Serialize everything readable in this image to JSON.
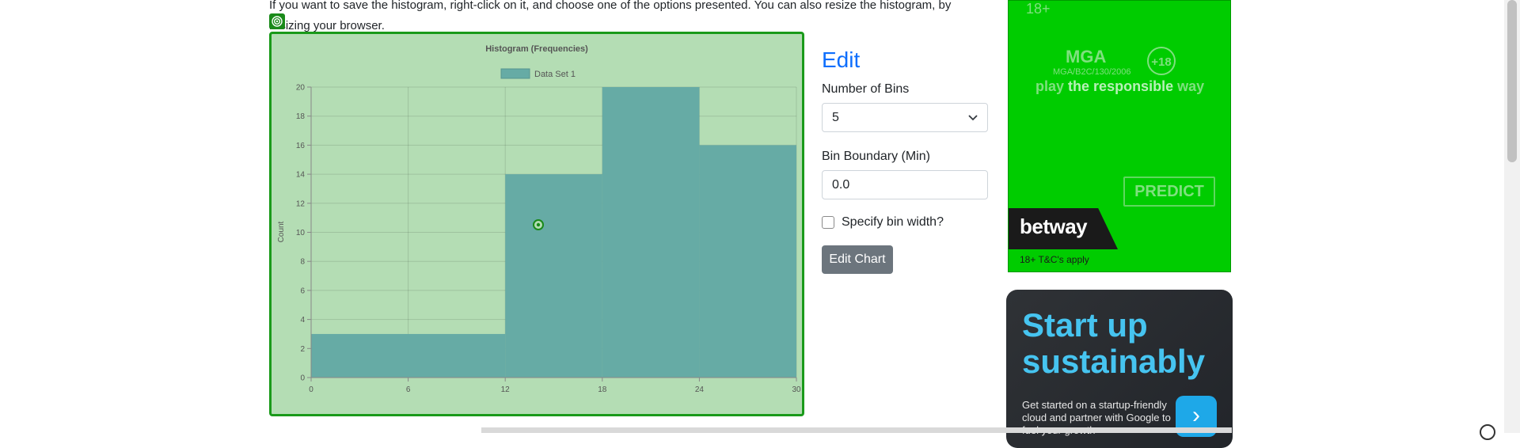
{
  "intro": {
    "line1": "If you want to save the histogram, right-click on it, and choose one of the options presented. You can also resize the histogram, by",
    "line2": "resizing your browser."
  },
  "chart_data": {
    "type": "bar",
    "title": "Histogram (Frequencies)",
    "legend": "Data Set 1",
    "legend_position": "top",
    "xlabel": "",
    "ylabel": "Count",
    "bins": [
      {
        "x0": 0,
        "x1": 12,
        "count": 3
      },
      {
        "x0": 12,
        "x1": 18,
        "count": 14
      },
      {
        "x0": 18,
        "x1": 24,
        "count": 20
      },
      {
        "x0": 24,
        "x1": 30,
        "count": 16
      }
    ],
    "x_ticks": [
      0,
      6,
      12,
      18,
      24,
      30
    ],
    "y_ticks": [
      0,
      2,
      4,
      6,
      8,
      10,
      12,
      14,
      16,
      18,
      20
    ],
    "xlim": [
      0,
      30
    ],
    "ylim": [
      0,
      20
    ],
    "grid": true,
    "bar_color": "#66aba5",
    "background_color": "#b4ddb4",
    "border_color": "#1a9a1a"
  },
  "edit_panel": {
    "title": "Edit",
    "bins_label": "Number of Bins",
    "bins_value": "5",
    "boundary_label": "Bin Boundary (Min)",
    "boundary_value": "0.0",
    "bin_width_label": "Specify bin width?",
    "bin_width_checked": false,
    "button_label": "Edit Chart"
  },
  "ad_betway": {
    "age_tag": "18+",
    "mga_logo": "MGA",
    "mga_code": "MGA/B2C/130/2006",
    "plus18": "+18",
    "play": "play",
    "responsible": "the responsible",
    "way": "way",
    "predict": "PREDICT",
    "brand": "betway",
    "tc": "18+ T&C's apply",
    "color": "#00cc00"
  },
  "ad_cloud": {
    "headline": "Start up sustainably",
    "body": "Get started on a startup-friendly cloud and partner with Google to fuel your growth",
    "arrow": "›",
    "accent": "#46c4f0"
  }
}
